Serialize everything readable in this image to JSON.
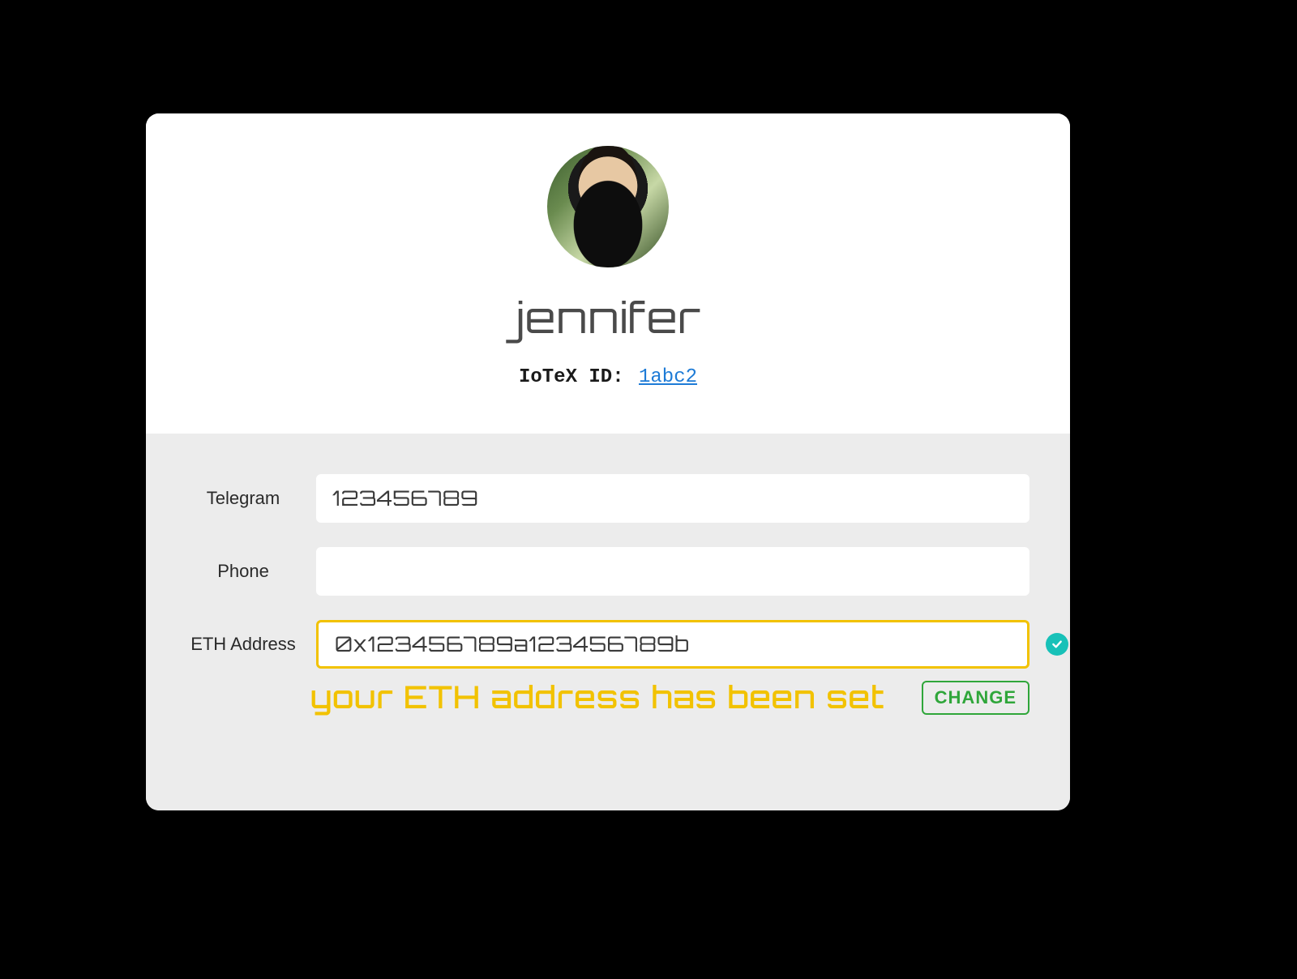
{
  "profile": {
    "username": "jennifer",
    "iotex_label": "IoTeX ID:",
    "iotex_id": "1abc2"
  },
  "form": {
    "telegram": {
      "label": "Telegram",
      "value": "123456789"
    },
    "phone": {
      "label": "Phone",
      "value": ""
    },
    "eth": {
      "label": "ETH Address",
      "value": "0x123456789a123456789b",
      "status_message": "your ETH  address has been set",
      "change_button": "CHANGE",
      "highlight_color": "#f2c200",
      "verified": true
    }
  },
  "colors": {
    "status_text": "#f2c200",
    "change_button": "#2fa63a",
    "verified_badge": "#18c1b8",
    "link": "#1e7bd6",
    "form_bg": "#ececec"
  },
  "icons": {
    "verified": "checkmark-circle-icon"
  }
}
